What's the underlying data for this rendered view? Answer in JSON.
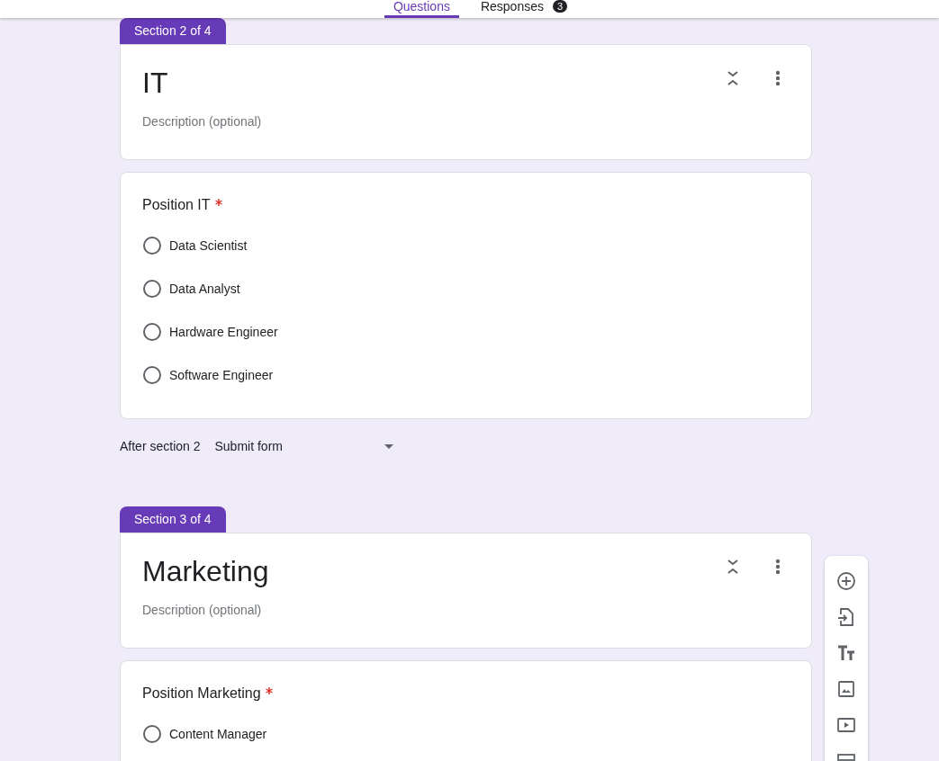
{
  "tabs": [
    {
      "label": "Questions",
      "selected": true
    },
    {
      "label": "Responses",
      "selected": false,
      "badge": "3"
    }
  ],
  "sections": [
    {
      "tag": "Section 2 of 4",
      "title": "IT",
      "description": {
        "placeholder": "Description (optional)"
      },
      "questions": [
        {
          "title": "Position IT",
          "required": true,
          "options": [
            {
              "label": "Data Scientist",
              "selected": false
            },
            {
              "label": "Data Analyst",
              "selected": false
            },
            {
              "label": "Hardware Engineer",
              "selected": false
            },
            {
              "label": "Software Engineer",
              "selected": false
            }
          ]
        }
      ],
      "after": {
        "label": "After section 2",
        "value": "Submit form"
      }
    },
    {
      "tag": "Section 3 of 4",
      "title": "Marketing",
      "description": {
        "placeholder": "Description (optional)"
      },
      "questions": [
        {
          "title": "Position Marketing",
          "required": true,
          "options": [
            {
              "label": "Content Manager",
              "selected": false
            }
          ]
        }
      ]
    }
  ]
}
